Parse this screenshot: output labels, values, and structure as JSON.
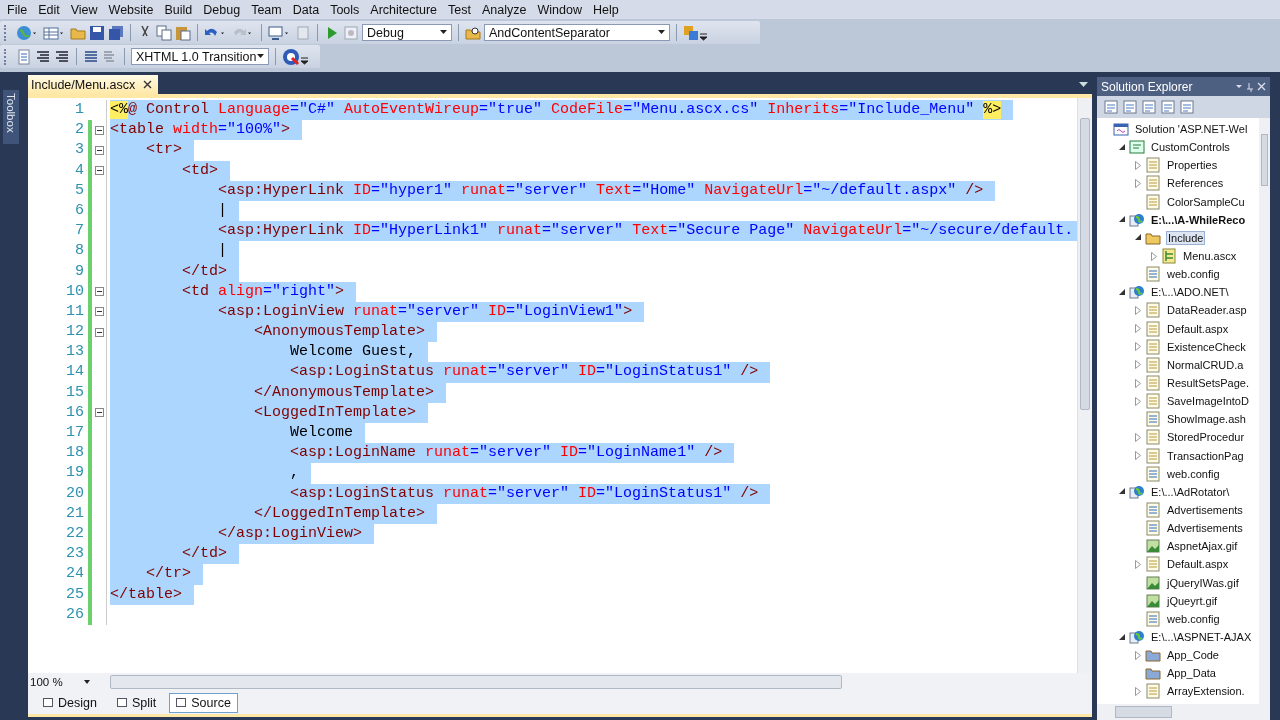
{
  "menu": [
    "File",
    "Edit",
    "View",
    "Website",
    "Build",
    "Debug",
    "Team",
    "Data",
    "Tools",
    "Architecture",
    "Test",
    "Analyze",
    "Window",
    "Help"
  ],
  "toolbar": {
    "configuration": "Debug",
    "find": "AndContentSeparator",
    "schema": "XHTML 1.0 Transition"
  },
  "side_tab": "Toolbox",
  "document_tab": {
    "label": "Include/Menu.ascx",
    "selected": true
  },
  "editor": {
    "lines": [
      {
        "n": "1",
        "selected": true,
        "changed": false,
        "fold": false,
        "tokens": [
          {
            "kind": "delim",
            "text": "<%"
          },
          {
            "kind": "tag",
            "text": "@ Control "
          },
          {
            "kind": "attr",
            "text": "Language"
          },
          {
            "kind": "value",
            "text": "=\"C#\" "
          },
          {
            "kind": "attr",
            "text": "AutoEventWireup"
          },
          {
            "kind": "value",
            "text": "=\"true\" "
          },
          {
            "kind": "attr",
            "text": "CodeFile"
          },
          {
            "kind": "value",
            "text": "=\"Menu.ascx.cs\" "
          },
          {
            "kind": "attr",
            "text": "Inherits"
          },
          {
            "kind": "value",
            "text": "=\"Include_Menu\" "
          },
          {
            "kind": "delim",
            "text": "%>"
          }
        ]
      },
      {
        "n": "2",
        "selected": true,
        "changed": true,
        "fold": true,
        "tokens": [
          {
            "kind": "tag",
            "text": "<table "
          },
          {
            "kind": "attr",
            "text": "width"
          },
          {
            "kind": "value",
            "text": "=\"100%\""
          },
          {
            "kind": "tag",
            "text": ">"
          }
        ]
      },
      {
        "n": "3",
        "selected": true,
        "changed": true,
        "fold": true,
        "tokens": [
          {
            "kind": "tag",
            "text": "    <tr>"
          }
        ]
      },
      {
        "n": "4",
        "selected": true,
        "changed": true,
        "fold": true,
        "tokens": [
          {
            "kind": "tag",
            "text": "        <td>"
          }
        ]
      },
      {
        "n": "5",
        "selected": true,
        "changed": true,
        "fold": false,
        "tokens": [
          {
            "kind": "tag",
            "text": "            <asp:HyperLink "
          },
          {
            "kind": "attr",
            "text": "ID"
          },
          {
            "kind": "value",
            "text": "=\"hyper1\" "
          },
          {
            "kind": "attr",
            "text": "runat"
          },
          {
            "kind": "value",
            "text": "=\"server\" "
          },
          {
            "kind": "attr",
            "text": "Text"
          },
          {
            "kind": "value",
            "text": "=\"Home\" "
          },
          {
            "kind": "attr",
            "text": "NavigateUrl"
          },
          {
            "kind": "value",
            "text": "=\"~/default.aspx\""
          },
          {
            "kind": "tag",
            "text": " />"
          }
        ]
      },
      {
        "n": "6",
        "selected": true,
        "changed": true,
        "fold": false,
        "tokens": [
          {
            "kind": "text",
            "text": "            |"
          }
        ]
      },
      {
        "n": "7",
        "selected": true,
        "changed": true,
        "fold": false,
        "tokens": [
          {
            "kind": "tag",
            "text": "            <asp:HyperLink "
          },
          {
            "kind": "attr",
            "text": "ID"
          },
          {
            "kind": "value",
            "text": "=\"HyperLink1\" "
          },
          {
            "kind": "attr",
            "text": "runat"
          },
          {
            "kind": "value",
            "text": "=\"server\" "
          },
          {
            "kind": "attr",
            "text": "Text"
          },
          {
            "kind": "value",
            "text": "=\"Secure Page\" "
          },
          {
            "kind": "attr",
            "text": "NavigateUrl"
          },
          {
            "kind": "value",
            "text": "=\"~/secure/default."
          }
        ]
      },
      {
        "n": "8",
        "selected": true,
        "changed": true,
        "fold": false,
        "tokens": [
          {
            "kind": "text",
            "text": "            |"
          }
        ]
      },
      {
        "n": "9",
        "selected": true,
        "changed": true,
        "fold": false,
        "tokens": [
          {
            "kind": "tag",
            "text": "        </td>"
          }
        ]
      },
      {
        "n": "10",
        "selected": true,
        "changed": true,
        "fold": true,
        "tokens": [
          {
            "kind": "tag",
            "text": "        <td "
          },
          {
            "kind": "attr",
            "text": "align"
          },
          {
            "kind": "value",
            "text": "=\"right\""
          },
          {
            "kind": "tag",
            "text": ">"
          }
        ]
      },
      {
        "n": "11",
        "selected": true,
        "changed": true,
        "fold": true,
        "tokens": [
          {
            "kind": "tag",
            "text": "            <asp:LoginView "
          },
          {
            "kind": "attr",
            "text": "runat"
          },
          {
            "kind": "value",
            "text": "=\"server\" "
          },
          {
            "kind": "attr",
            "text": "ID"
          },
          {
            "kind": "value",
            "text": "=\"LoginView1\""
          },
          {
            "kind": "tag",
            "text": ">"
          }
        ]
      },
      {
        "n": "12",
        "selected": true,
        "changed": true,
        "fold": true,
        "tokens": [
          {
            "kind": "tag",
            "text": "                <AnonymousTemplate>"
          }
        ]
      },
      {
        "n": "13",
        "selected": true,
        "changed": true,
        "fold": false,
        "tokens": [
          {
            "kind": "text",
            "text": "                    Welcome Guest,"
          }
        ]
      },
      {
        "n": "14",
        "selected": true,
        "changed": true,
        "fold": false,
        "tokens": [
          {
            "kind": "tag",
            "text": "                    <asp:LoginStatus "
          },
          {
            "kind": "attr",
            "text": "runat"
          },
          {
            "kind": "value",
            "text": "=\"server\" "
          },
          {
            "kind": "attr",
            "text": "ID"
          },
          {
            "kind": "value",
            "text": "=\"LoginStatus1\""
          },
          {
            "kind": "tag",
            "text": " />"
          }
        ]
      },
      {
        "n": "15",
        "selected": true,
        "changed": true,
        "fold": false,
        "tokens": [
          {
            "kind": "tag",
            "text": "                </AnonymousTemplate>"
          }
        ]
      },
      {
        "n": "16",
        "selected": true,
        "changed": true,
        "fold": true,
        "tokens": [
          {
            "kind": "tag",
            "text": "                <LoggedInTemplate>"
          }
        ]
      },
      {
        "n": "17",
        "selected": true,
        "changed": true,
        "fold": false,
        "tokens": [
          {
            "kind": "text",
            "text": "                    Welcome"
          }
        ]
      },
      {
        "n": "18",
        "selected": true,
        "changed": true,
        "fold": false,
        "tokens": [
          {
            "kind": "tag",
            "text": "                    <asp:LoginName "
          },
          {
            "kind": "attr",
            "text": "runat"
          },
          {
            "kind": "value",
            "text": "=\"server\" "
          },
          {
            "kind": "attr",
            "text": "ID"
          },
          {
            "kind": "value",
            "text": "=\"LoginName1\""
          },
          {
            "kind": "tag",
            "text": " />"
          }
        ]
      },
      {
        "n": "19",
        "selected": true,
        "changed": true,
        "fold": false,
        "tokens": [
          {
            "kind": "text",
            "text": "                    ,"
          }
        ]
      },
      {
        "n": "20",
        "selected": true,
        "changed": true,
        "fold": false,
        "tokens": [
          {
            "kind": "tag",
            "text": "                    <asp:LoginStatus "
          },
          {
            "kind": "attr",
            "text": "runat"
          },
          {
            "kind": "value",
            "text": "=\"server\" "
          },
          {
            "kind": "attr",
            "text": "ID"
          },
          {
            "kind": "value",
            "text": "=\"LoginStatus1\""
          },
          {
            "kind": "tag",
            "text": " />"
          }
        ]
      },
      {
        "n": "21",
        "selected": true,
        "changed": true,
        "fold": false,
        "tokens": [
          {
            "kind": "tag",
            "text": "                </LoggedInTemplate>"
          }
        ]
      },
      {
        "n": "22",
        "selected": true,
        "changed": true,
        "fold": false,
        "tokens": [
          {
            "kind": "tag",
            "text": "            </asp:LoginView>"
          }
        ]
      },
      {
        "n": "23",
        "selected": true,
        "changed": true,
        "fold": false,
        "tokens": [
          {
            "kind": "tag",
            "text": "        </td>"
          }
        ]
      },
      {
        "n": "24",
        "selected": true,
        "changed": true,
        "fold": false,
        "tokens": [
          {
            "kind": "tag",
            "text": "    </tr>"
          }
        ]
      },
      {
        "n": "25",
        "selected": true,
        "changed": true,
        "fold": false,
        "tokens": [
          {
            "kind": "tag",
            "text": "</table>"
          }
        ]
      },
      {
        "n": "26",
        "selected": false,
        "changed": true,
        "fold": false
      }
    ],
    "zoom": "100 %",
    "views": [
      {
        "label": "Design",
        "selected": false
      },
      {
        "label": "Split",
        "selected": false
      },
      {
        "label": "Source",
        "selected": true
      }
    ]
  },
  "solution_explorer": {
    "title": "Solution Explorer",
    "tree": [
      {
        "label": "Solution 'ASP.NET-Wel",
        "kind": "solution",
        "selected": false,
        "children": [
          {
            "label": "CustomControls",
            "kind": "csproj",
            "expanded": true,
            "selected": false,
            "bold": false,
            "children": [
              {
                "label": "Properties",
                "kind": "properties",
                "expanded": false,
                "selected": false
              },
              {
                "label": "References",
                "kind": "references",
                "expanded": false,
                "selected": false
              },
              {
                "label": "ColorSampleCu",
                "kind": "cs",
                "selected": false
              }
            ]
          },
          {
            "label": "E:\\...\\A-WhileReco",
            "kind": "web",
            "expanded": true,
            "selected": false,
            "bold": true,
            "children": [
              {
                "label": "Include",
                "kind": "folder",
                "expanded": true,
                "selected": true,
                "children": [
                  {
                    "label": "Menu.ascx",
                    "kind": "control",
                    "expanded": false,
                    "selected": false
                  }
                ]
              },
              {
                "label": "web.config",
                "kind": "config",
                "selected": false
              }
            ]
          },
          {
            "label": "E:\\...\\ADO.NET\\",
            "kind": "web",
            "expanded": true,
            "selected": false,
            "bold": false,
            "children": [
              {
                "label": "DataReader.asp",
                "kind": "page",
                "expanded": false,
                "selected": false
              },
              {
                "label": "Default.aspx",
                "kind": "page",
                "expanded": false,
                "selected": false
              },
              {
                "label": "ExistenceCheck",
                "kind": "page",
                "expanded": false,
                "selected": false
              },
              {
                "label": "NormalCRUD.a",
                "kind": "page",
                "expanded": false,
                "selected": false
              },
              {
                "label": "ResultSetsPage.",
                "kind": "page",
                "expanded": false,
                "selected": false
              },
              {
                "label": "SaveImageIntoD",
                "kind": "page",
                "expanded": false,
                "selected": false
              },
              {
                "label": "ShowImage.ash",
                "kind": "handler",
                "selected": false
              },
              {
                "label": "StoredProcedur",
                "kind": "page",
                "expanded": false,
                "selected": false
              },
              {
                "label": "TransactionPag",
                "kind": "page",
                "expanded": false,
                "selected": false
              },
              {
                "label": "web.config",
                "kind": "config",
                "selected": false
              }
            ]
          },
          {
            "label": "E:\\...\\AdRotator\\",
            "kind": "web",
            "expanded": true,
            "selected": false,
            "bold": false,
            "children": [
              {
                "label": "Advertisements",
                "kind": "xml",
                "selected": false
              },
              {
                "label": "Advertisements",
                "kind": "xml",
                "selected": false
              },
              {
                "label": "AspnetAjax.gif",
                "kind": "image",
                "selected": false
              },
              {
                "label": "Default.aspx",
                "kind": "page",
                "expanded": false,
                "selected": false
              },
              {
                "label": "jQueryIWas.gif",
                "kind": "image",
                "selected": false
              },
              {
                "label": "jQueyrt.gif",
                "kind": "image",
                "selected": false
              },
              {
                "label": "web.config",
                "kind": "config",
                "selected": false
              }
            ]
          },
          {
            "label": "E:\\...\\ASPNET-AJAX",
            "kind": "web",
            "expanded": true,
            "selected": false,
            "bold": false,
            "children": [
              {
                "label": "App_Code",
                "kind": "appfolder",
                "expanded": false,
                "selected": false
              },
              {
                "label": "App_Data",
                "kind": "appfolder",
                "selected": false
              },
              {
                "label": "ArrayExtension.",
                "kind": "page",
                "expanded": false,
                "selected": false
              }
            ]
          }
        ]
      }
    ]
  }
}
